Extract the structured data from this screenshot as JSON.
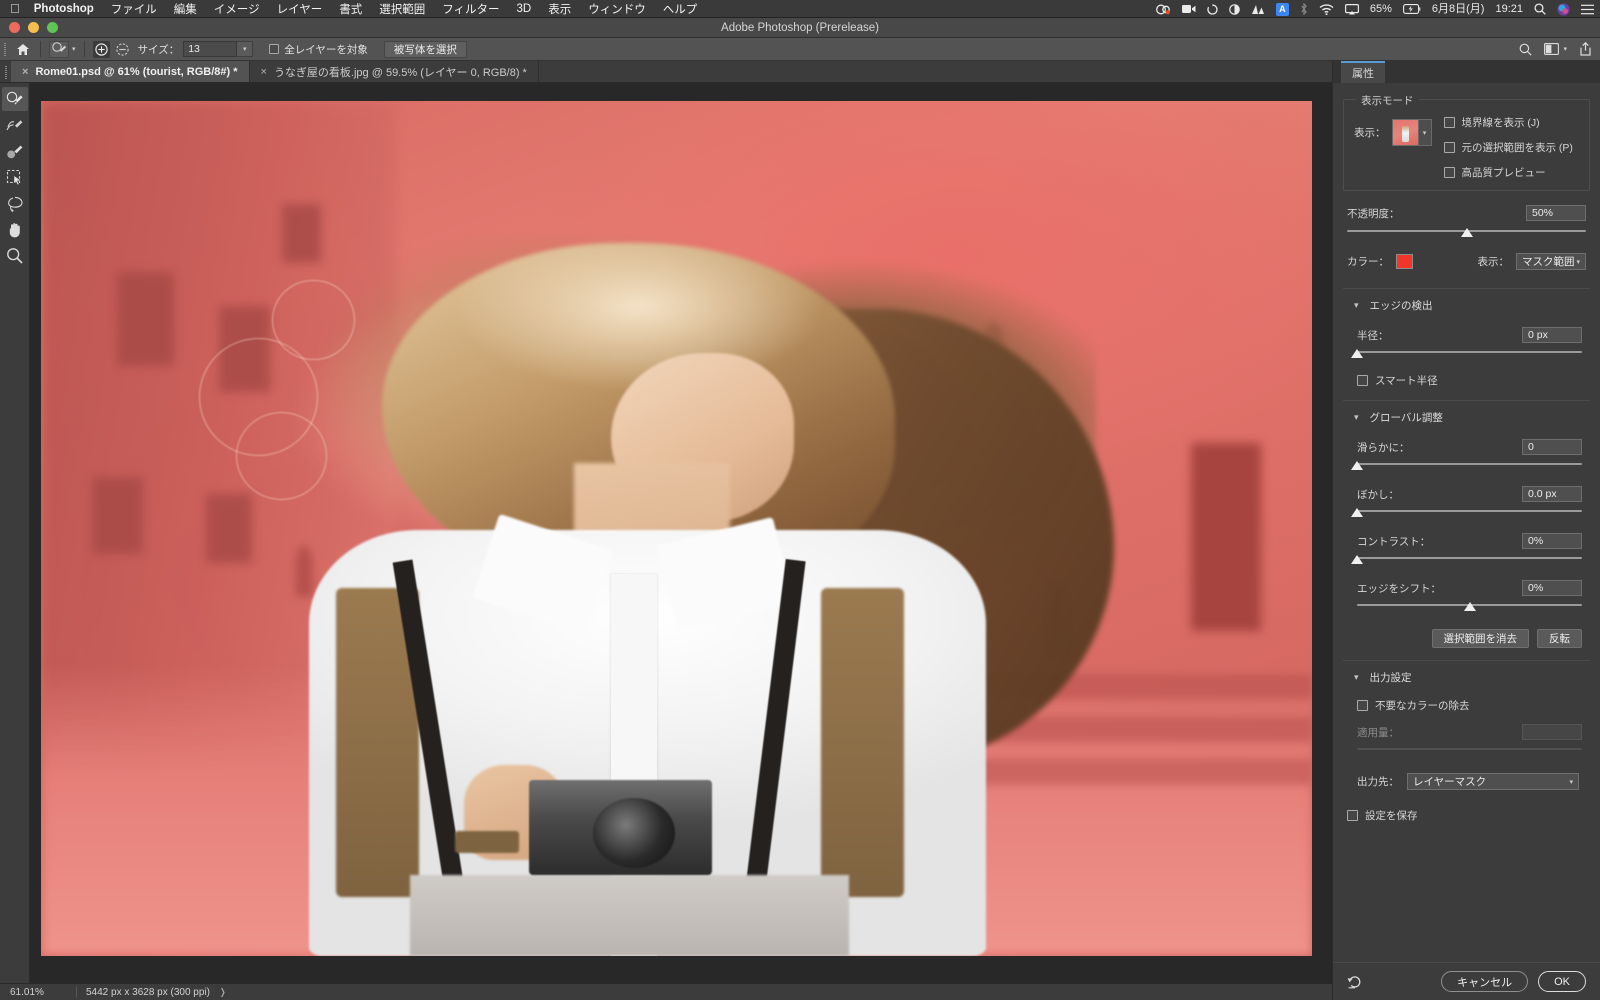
{
  "macbar": {
    "apple_icon": "apple-logo",
    "app_name": "Photoshop",
    "menus": [
      "ファイル",
      "編集",
      "イメージ",
      "レイヤー",
      "書式",
      "選択範囲",
      "フィルター",
      "3D",
      "表示",
      "ウィンドウ",
      "ヘルプ"
    ],
    "status": {
      "battery_percent": "65%",
      "date": "6月8日(月)",
      "time": "19:21",
      "icons": [
        "screen-record-icon",
        "camera-video-icon",
        "sync-icon",
        "contrast-icon",
        "analytics-icon",
        "input-source-a-icon",
        "bluetooth-icon",
        "wifi-icon",
        "airplay-icon",
        "battery-charging-icon",
        "spotlight-search-icon",
        "siri-icon",
        "control-center-icon"
      ]
    }
  },
  "window": {
    "title": "Adobe Photoshop (Prerelease)",
    "traffic_lights": [
      "close-button",
      "minimize-button",
      "zoom-button"
    ]
  },
  "options_bar": {
    "home_icon": "home-icon",
    "tool_icon": "quick-selection-brush-icon",
    "add_icon": "add-to-selection-icon",
    "subtract_icon": "subtract-from-selection-icon",
    "size_label": "サイズ：",
    "size_value": "13",
    "all_layers_label": "全レイヤーを対象",
    "all_layers_checked": false,
    "select_subject_label": "被写体を選択",
    "right_icons": [
      "search-icon",
      "workspace-icon",
      "share-icon"
    ]
  },
  "tabs": [
    {
      "label": "Rome01.psd @ 61% (tourist, RGB/8#) *",
      "active": true
    },
    {
      "label": "うなぎ屋の看板.jpg @ 59.5% (レイヤー 0, RGB/8) *",
      "active": false
    }
  ],
  "toolbar": {
    "tools": [
      {
        "name": "quick-selection-brush-tool",
        "active": true
      },
      {
        "name": "refine-edge-brush-tool",
        "active": false
      },
      {
        "name": "brush-tool",
        "active": false
      },
      {
        "name": "object-selection-tool",
        "active": false
      },
      {
        "name": "lasso-tool",
        "active": false
      },
      {
        "name": "hand-tool",
        "active": false
      },
      {
        "name": "zoom-tool",
        "active": false
      }
    ]
  },
  "status_bar": {
    "zoom": "61.01%",
    "dimensions": "5442 px x 3628 px (300 ppi)",
    "expand_icon": "chevron-right-icon"
  },
  "panel": {
    "tab_label": "属性",
    "view_mode": {
      "legend": "表示モード",
      "view_label": "表示：",
      "thumb_name": "view-mode-preview-thumbnail",
      "checks": [
        {
          "label": "境界線を表示 (J)",
          "checked": false
        },
        {
          "label": "元の選択範囲を表示 (P)",
          "checked": false
        },
        {
          "label": "高品質プレビュー",
          "checked": false
        }
      ],
      "opacity_label": "不透明度：",
      "opacity_value": "50%",
      "opacity_slider_pct": 50,
      "color_label": "カラー：",
      "color_value": "#f33529",
      "display_label": "表示：",
      "display_value": "マスク範囲"
    },
    "edge_detection": {
      "title": "エッジの検出",
      "radius_label": "半径：",
      "radius_value": "0 px",
      "radius_slider_pct": 0,
      "smart_radius_label": "スマート半径",
      "smart_radius_checked": false
    },
    "global_refinement": {
      "title": "グローバル調整",
      "fields": [
        {
          "label": "滑らかに：",
          "value": "0",
          "slider_pct": 0
        },
        {
          "label": "ぼかし：",
          "value": "0.0 px",
          "slider_pct": 0
        },
        {
          "label": "コントラスト：",
          "value": "0%",
          "slider_pct": 0
        },
        {
          "label": "エッジをシフト：",
          "value": "0%",
          "slider_pct": 50
        }
      ],
      "clear_button": "選択範囲を消去",
      "invert_button": "反転"
    },
    "output_settings": {
      "title": "出力設定",
      "decontaminate_label": "不要なカラーの除去",
      "decontaminate_checked": false,
      "amount_label": "適用量：",
      "amount_value": "",
      "amount_slider_pct": 0,
      "output_to_label": "出力先：",
      "output_to_value": "レイヤーマスク",
      "save_settings_label": "設定を保存",
      "save_settings_checked": false
    },
    "footer": {
      "reset_icon": "reset-icon",
      "cancel_label": "キャンセル",
      "ok_label": "OK"
    }
  }
}
